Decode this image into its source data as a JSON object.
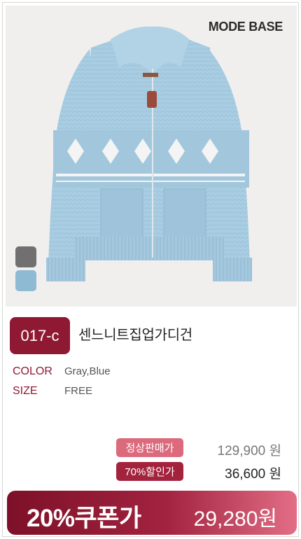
{
  "brand": "MODE BASE",
  "product": {
    "code": "017-c",
    "name": "센느니트집업가디건",
    "specs": {
      "color_label": "COLOR",
      "color_value": "Gray,Blue",
      "size_label": "SIZE",
      "size_value": "FREE"
    },
    "swatches": [
      {
        "name": "Gray",
        "hex": "#707070"
      },
      {
        "name": "Blue",
        "hex": "#8fbad3"
      }
    ]
  },
  "pricing": {
    "normal_label": "정상판매가",
    "normal_price": "129,900 원",
    "sale_label": "70%할인가",
    "sale_price": "36,600 원",
    "coupon_label": "20%쿠폰가",
    "coupon_price": "29,280원"
  },
  "colors": {
    "accent": "#8f1933",
    "normal_pill": "#dc6a7d",
    "sale_pill": "#a3233d"
  }
}
